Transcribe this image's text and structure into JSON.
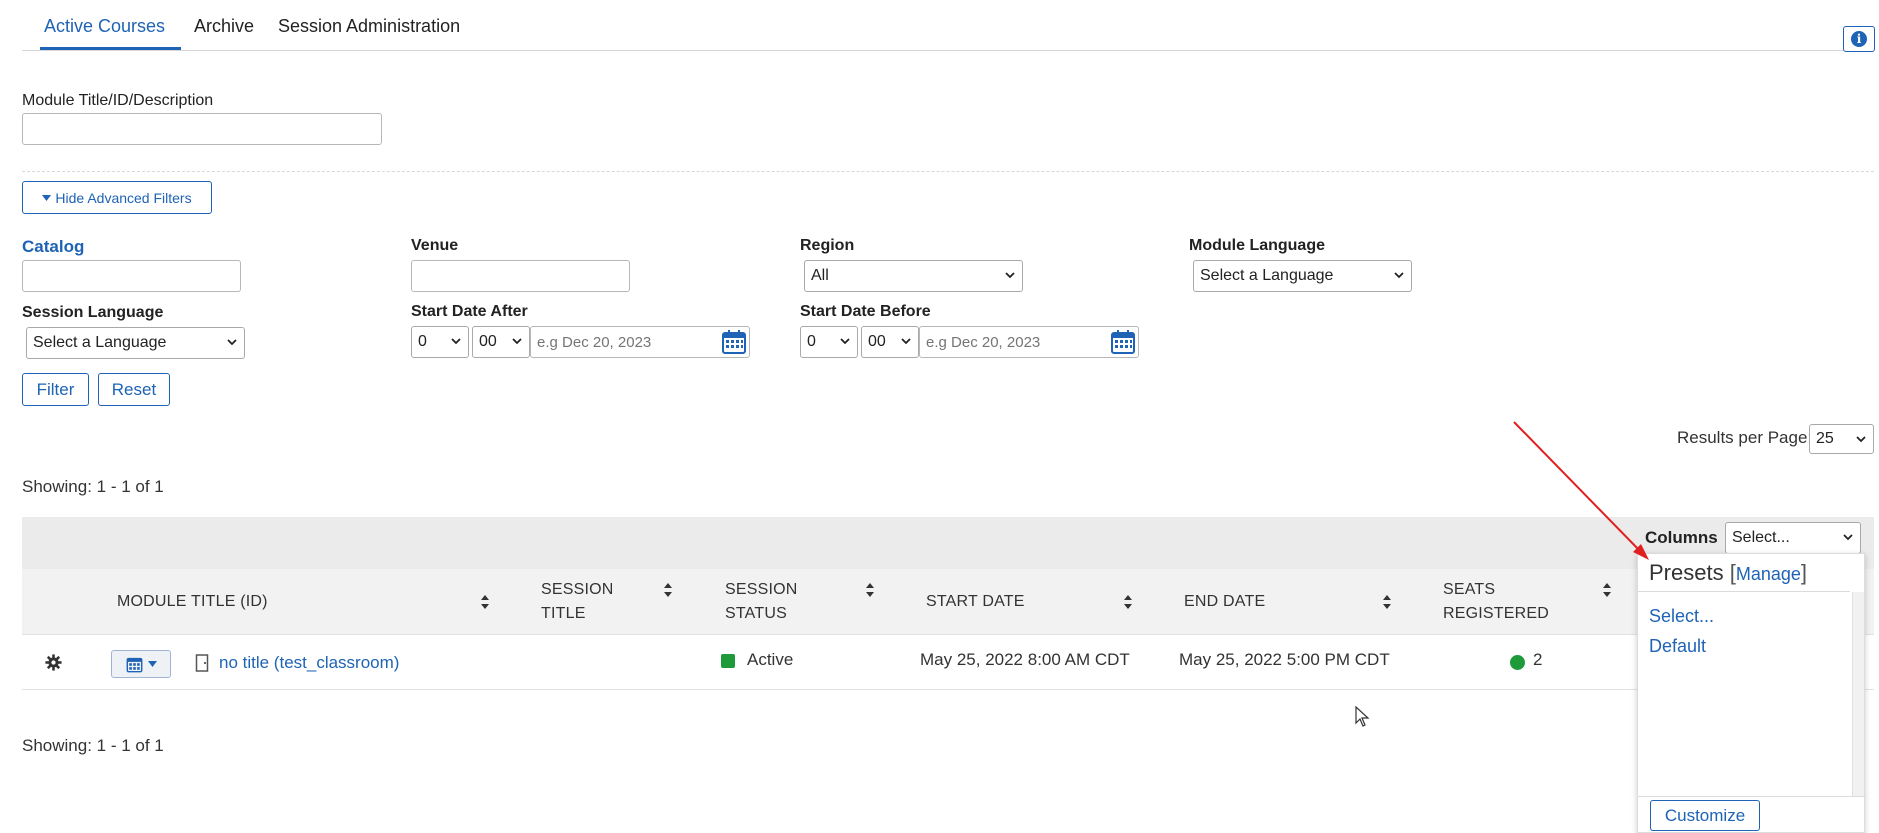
{
  "tabs": [
    "Active Courses",
    "Archive",
    "Session Administration"
  ],
  "filters": {
    "module_title_label": "Module Title/ID/Description",
    "module_title_value": "",
    "hide_advanced_label": "Hide Advanced Filters",
    "catalog_label": "Catalog",
    "venue_label": "Venue",
    "region_label": "Region",
    "region_value": "All",
    "module_language_label": "Module Language",
    "module_language_value": "Select a Language",
    "session_language_label": "Session Language",
    "session_language_value": "Select a Language",
    "start_after_label": "Start Date After",
    "start_before_label": "Start Date Before",
    "hour_value": "0",
    "minute_value": "00",
    "date_placeholder": "e.g Dec 20, 2023",
    "filter_button": "Filter",
    "reset_button": "Reset"
  },
  "results": {
    "per_page_label": "Results per Page:",
    "per_page_value": "25",
    "showing_top": "Showing: 1 - 1 of 1",
    "showing_bottom": "Showing: 1 - 1 of 1"
  },
  "columns": {
    "label": "Columns",
    "select_value": "Select..."
  },
  "table": {
    "headers": {
      "module_title": "MODULE TITLE (ID)",
      "session_title_1": "SESSION",
      "session_title_2": "TITLE",
      "session_status_1": "SESSION",
      "session_status_2": "STATUS",
      "start_date": "START DATE",
      "end_date": "END DATE",
      "seats_1": "SEATS",
      "seats_2": "REGISTERED"
    },
    "rows": [
      {
        "module_title": "no title (test_classroom)",
        "status": "Active",
        "start_date": "May 25, 2022 8:00 AM CDT",
        "end_date": "May 25, 2022 5:00 PM CDT",
        "seats": "2"
      }
    ]
  },
  "presets": {
    "title": "Presets",
    "bracket_open": "[",
    "manage": "Manage",
    "bracket_close": "]",
    "items": [
      "Select...",
      "Default"
    ],
    "customize_button": "Customize"
  },
  "colors": {
    "accent": "#1e63b5",
    "active_status": "#1e9a3a",
    "annotation_arrow": "#e02020"
  }
}
